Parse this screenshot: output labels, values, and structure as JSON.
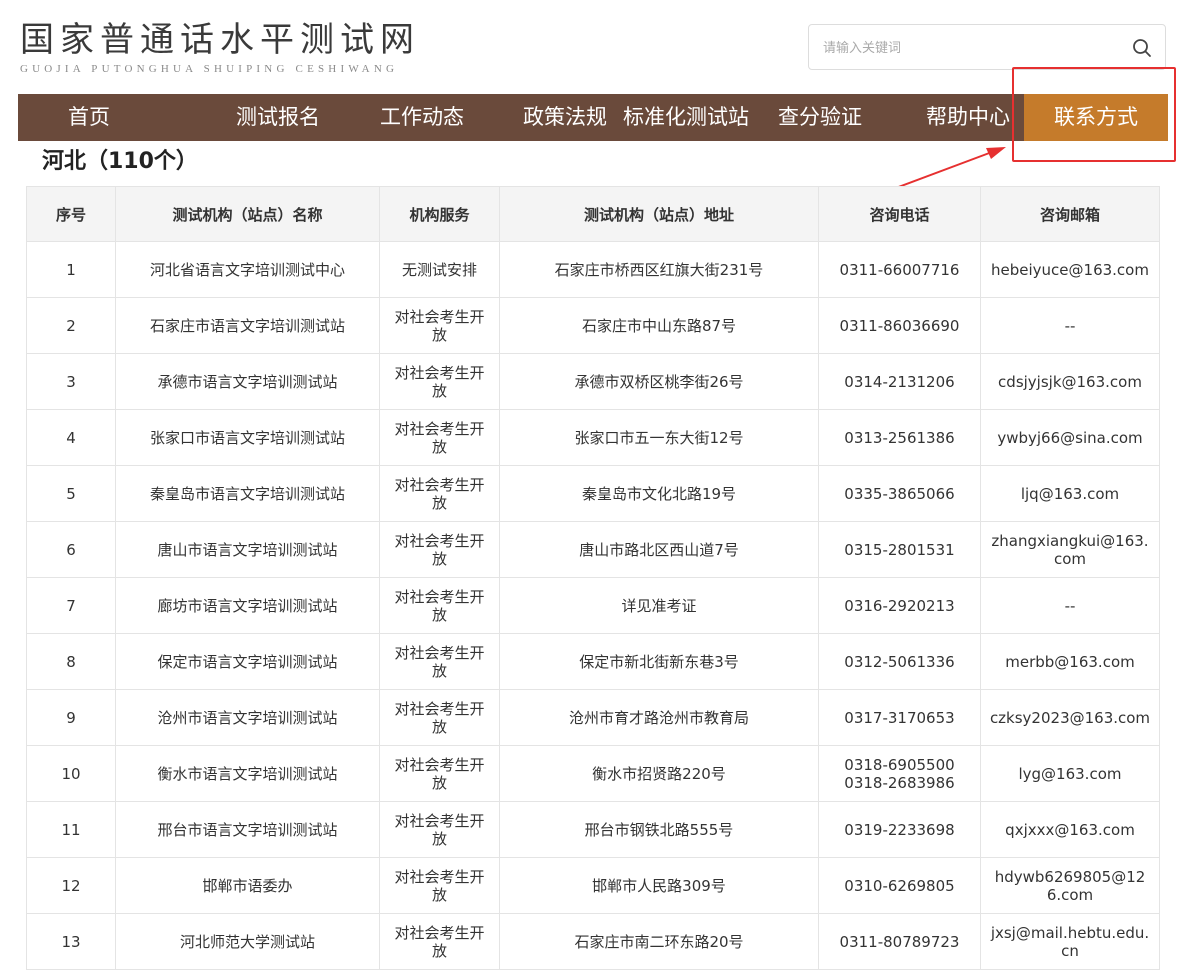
{
  "logo": {
    "cn": "国家普通话水平测试网",
    "en": "GUOJIA PUTONGHUA SHUIPING CESHIWANG"
  },
  "search": {
    "placeholder": "请输入关键词",
    "icon": "search-icon"
  },
  "nav": [
    "首页",
    "测试报名",
    "工作动态",
    "政策法规",
    "标准化测试站",
    "查分验证",
    "帮助中心",
    "联系方式"
  ],
  "nav_active": "联系方式",
  "region_title": "河北（110个）",
  "table": {
    "headers": [
      "序号",
      "测试机构（站点）名称",
      "机构服务",
      "测试机构（站点）地址",
      "咨询电话",
      "咨询邮箱"
    ],
    "rows": [
      [
        "1",
        "河北省语言文字培训测试中心",
        "无测试安排",
        "石家庄市桥西区红旗大街231号",
        "0311-66007716",
        "hebeiyuce@163.com"
      ],
      [
        "2",
        "石家庄市语言文字培训测试站",
        "对社会考生开放",
        "石家庄市中山东路87号",
        "0311-86036690",
        "--"
      ],
      [
        "3",
        "承德市语言文字培训测试站",
        "对社会考生开放",
        "承德市双桥区桃李街26号",
        "0314-2131206",
        "cdsjyjsjk@163.com"
      ],
      [
        "4",
        "张家口市语言文字培训测试站",
        "对社会考生开放",
        "张家口市五一东大街12号",
        "0313-2561386",
        "ywbyj66@sina.com"
      ],
      [
        "5",
        "秦皇岛市语言文字培训测试站",
        "对社会考生开放",
        "秦皇岛市文化北路19号",
        "0335-3865066",
        "ljq@163.com"
      ],
      [
        "6",
        "唐山市语言文字培训测试站",
        "对社会考生开放",
        "唐山市路北区西山道7号",
        "0315-2801531",
        "zhangxiangkui@163.com"
      ],
      [
        "7",
        "廊坊市语言文字培训测试站",
        "对社会考生开放",
        "详见准考证",
        "0316-2920213",
        "--"
      ],
      [
        "8",
        "保定市语言文字培训测试站",
        "对社会考生开放",
        "保定市新北街新东巷3号",
        "0312-5061336",
        "merbb@163.com"
      ],
      [
        "9",
        "沧州市语言文字培训测试站",
        "对社会考生开放",
        "沧州市育才路沧州市教育局",
        "0317-3170653",
        "czksy2023@163.com"
      ],
      [
        "10",
        "衡水市语言文字培训测试站",
        "对社会考生开放",
        "衡水市招贤路220号",
        "0318-6905500\n0318-2683986",
        "lyg@163.com"
      ],
      [
        "11",
        "邢台市语言文字培训测试站",
        "对社会考生开放",
        "邢台市钢铁北路555号",
        "0319-2233698",
        "qxjxxx@163.com"
      ],
      [
        "12",
        "邯郸市语委办",
        "对社会考生开放",
        "邯郸市人民路309号",
        "0310-6269805",
        "hdywb6269805@126.com"
      ],
      [
        "13",
        "河北师范大学测试站",
        "对社会考生开放",
        "石家庄市南二环东路20号",
        "0311-80789723",
        "jxsj@mail.hebtu.edu.cn"
      ]
    ]
  },
  "colors": {
    "nav_bg": "#6a4a3b",
    "nav_active": "#c57b2b",
    "annotation": "#e63030"
  }
}
